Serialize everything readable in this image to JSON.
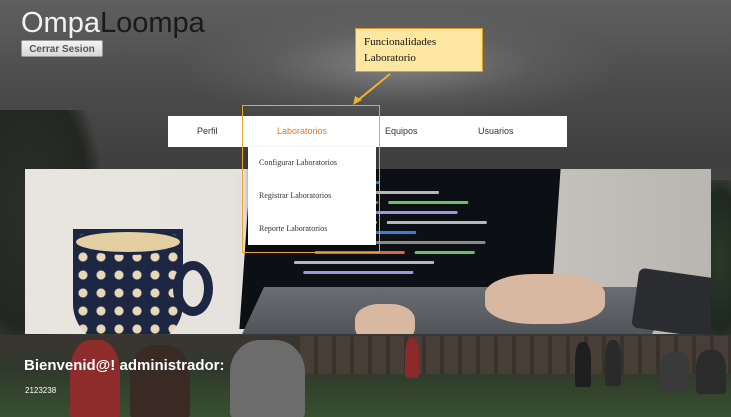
{
  "header": {
    "brand_part1": "Ompa",
    "brand_part2": "Loompa",
    "logout_label": "Cerrar Sesion"
  },
  "callout": {
    "line1": "Funcionalidades",
    "line2": "Laboratorio"
  },
  "nav": {
    "items": [
      {
        "label": "Perfil"
      },
      {
        "label": "Laboratorios",
        "active": true
      },
      {
        "label": "Equipos"
      },
      {
        "label": "Usuarios"
      }
    ]
  },
  "dropdown": {
    "items": [
      {
        "label": "Configurar Laboratorios"
      },
      {
        "label": "Registrar Laboratorios"
      },
      {
        "label": "Reporte Laboratorios"
      }
    ]
  },
  "welcome": {
    "text": "Bienvenid@! administrador:",
    "code": "2123238"
  },
  "colors": {
    "accent": "#e07a2a",
    "callout_bg": "#fde7a1",
    "callout_border": "#e39b23"
  }
}
